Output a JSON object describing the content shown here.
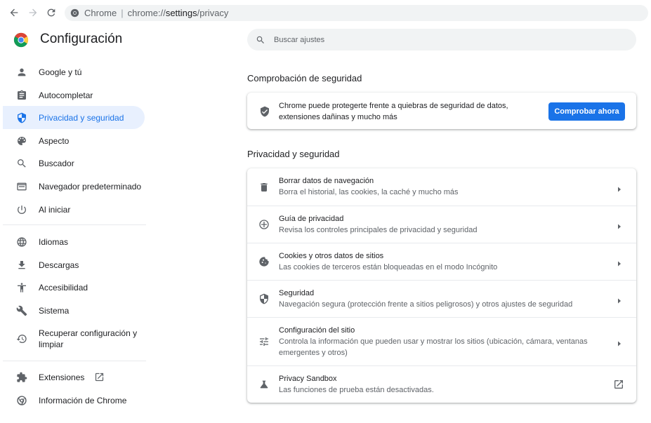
{
  "browser": {
    "omnibox_site": "Chrome",
    "omnibox_separator": "|",
    "omnibox_scheme": "chrome://",
    "omnibox_host": "settings",
    "omnibox_path": "/privacy"
  },
  "header": {
    "title": "Configuración",
    "search_placeholder": "Buscar ajustes"
  },
  "sidebar": {
    "items": [
      {
        "label": "Google y tú",
        "icon": "person-icon"
      },
      {
        "label": "Autocompletar",
        "icon": "clipboard-icon"
      },
      {
        "label": "Privacidad y seguridad",
        "icon": "shield-icon",
        "active": true
      },
      {
        "label": "Aspecto",
        "icon": "palette-icon"
      },
      {
        "label": "Buscador",
        "icon": "search-icon"
      },
      {
        "label": "Navegador predeterminado",
        "icon": "browser-icon"
      },
      {
        "label": "Al iniciar",
        "icon": "power-icon"
      },
      {
        "label": "Idiomas",
        "icon": "globe-icon"
      },
      {
        "label": "Descargas",
        "icon": "download-icon"
      },
      {
        "label": "Accesibilidad",
        "icon": "accessibility-icon"
      },
      {
        "label": "Sistema",
        "icon": "wrench-icon"
      },
      {
        "label": "Recuperar configuración y limpiar",
        "icon": "restore-icon"
      },
      {
        "label": "Extensiones",
        "icon": "puzzle-icon"
      },
      {
        "label": "Información de Chrome",
        "icon": "chrome-icon"
      }
    ]
  },
  "safety_check": {
    "section_title": "Comprobación de seguridad",
    "text": "Chrome puede protegerte frente a quiebras de seguridad de datos, extensiones dañinas y mucho más",
    "button_label": "Comprobar ahora"
  },
  "privacy": {
    "section_title": "Privacidad y seguridad",
    "rows": [
      {
        "title": "Borrar datos de navegación",
        "subtitle": "Borra el historial, las cookies, la caché y mucho más",
        "icon": "trash-icon"
      },
      {
        "title": "Guía de privacidad",
        "subtitle": "Revisa los controles principales de privacidad y seguridad",
        "icon": "compass-icon"
      },
      {
        "title": "Cookies y otros datos de sitios",
        "subtitle": "Las cookies de terceros están bloqueadas en el modo Incógnito",
        "icon": "cookie-icon"
      },
      {
        "title": "Seguridad",
        "subtitle": "Navegación segura (protección frente a sitios peligrosos) y otros ajustes de seguridad",
        "icon": "shield-icon"
      },
      {
        "title": "Configuración del sitio",
        "subtitle": "Controla la información que pueden usar y mostrar los sitios (ubicación, cámara, ventanas emergentes y otros)",
        "icon": "tune-icon"
      },
      {
        "title": "Privacy Sandbox",
        "subtitle": "Las funciones de prueba están desactivadas.",
        "icon": "flask-icon"
      }
    ]
  },
  "colors": {
    "accent": "#1a73e8",
    "active_bg": "#e8f0fe",
    "text": "#202124",
    "secondary_text": "#5f6368"
  }
}
